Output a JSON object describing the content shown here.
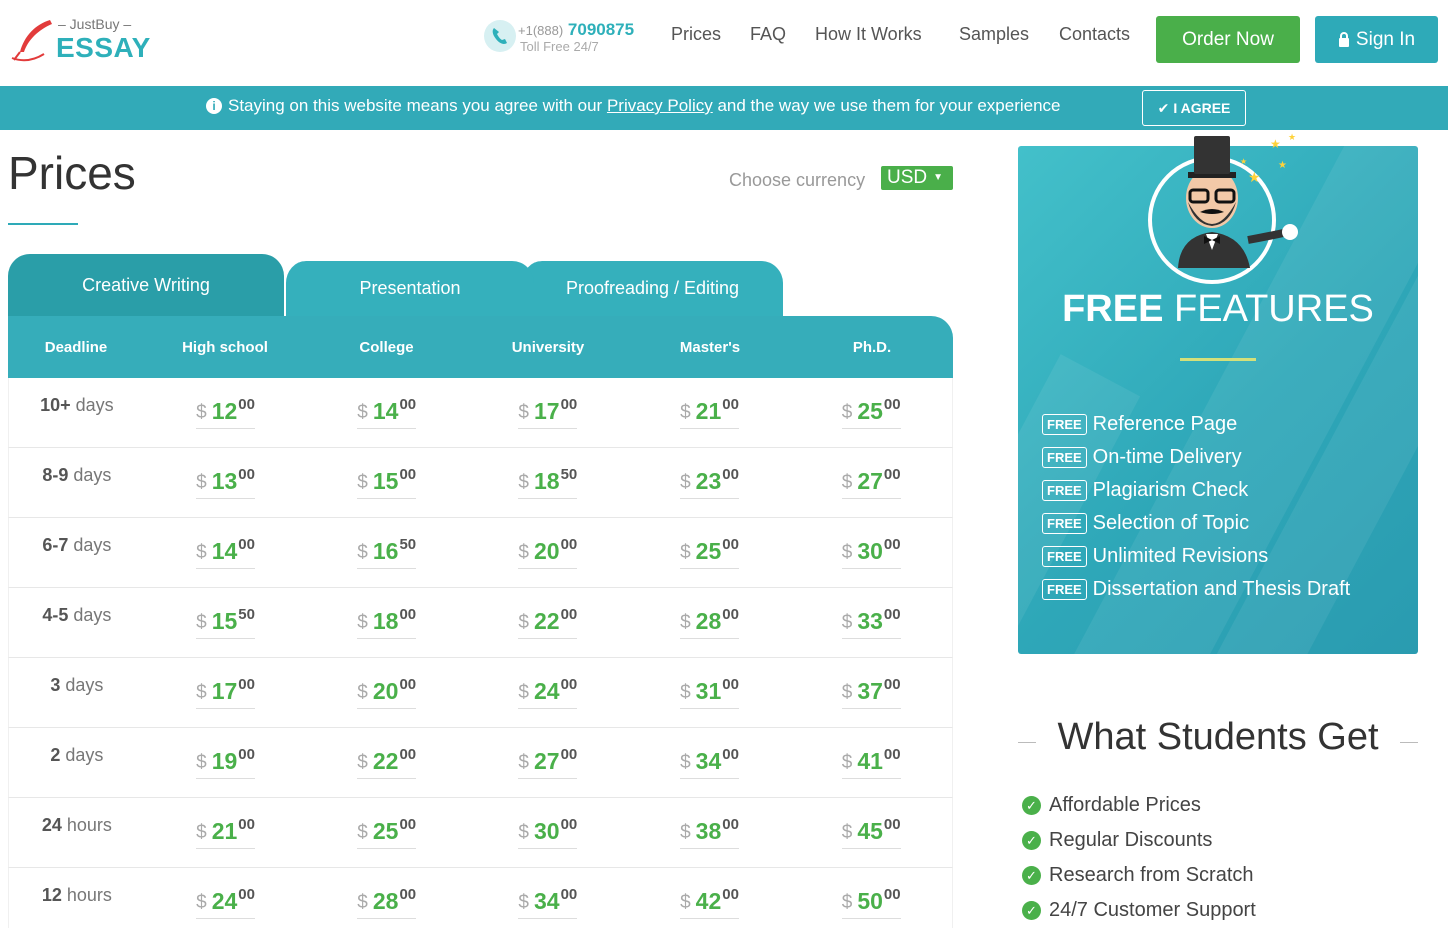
{
  "header": {
    "logo_top": "– JustBuy –",
    "logo_main": "ESSAY",
    "phone_prefix": "+1(888)",
    "phone_number": "7090875",
    "phone_sub": "Toll Free 24/7",
    "nav": [
      "Prices",
      "FAQ",
      "How It Works",
      "Samples",
      "Contacts"
    ],
    "order_label": "Order Now",
    "signin_label": "Sign In"
  },
  "cookie": {
    "text_before": "Staying on this website means you agree with our ",
    "link": "Privacy Policy",
    "text_after": " and the way we use them for your experience",
    "agree_label": "I AGREE"
  },
  "page": {
    "title": "Prices",
    "currency_label": "Choose currency",
    "currency_value": "USD"
  },
  "tabs": [
    "Creative Writing",
    "Presentation",
    "Proofreading / Editing"
  ],
  "table": {
    "headers": [
      "Deadline",
      "High school",
      "College",
      "University",
      "Master's",
      "Ph.D."
    ],
    "currency_symbol": "$",
    "rows": [
      {
        "num": "10+",
        "unit": "days",
        "prices": [
          [
            "12",
            "00"
          ],
          [
            "14",
            "00"
          ],
          [
            "17",
            "00"
          ],
          [
            "21",
            "00"
          ],
          [
            "25",
            "00"
          ]
        ]
      },
      {
        "num": "8-9",
        "unit": "days",
        "prices": [
          [
            "13",
            "00"
          ],
          [
            "15",
            "00"
          ],
          [
            "18",
            "50"
          ],
          [
            "23",
            "00"
          ],
          [
            "27",
            "00"
          ]
        ]
      },
      {
        "num": "6-7",
        "unit": "days",
        "prices": [
          [
            "14",
            "00"
          ],
          [
            "16",
            "50"
          ],
          [
            "20",
            "00"
          ],
          [
            "25",
            "00"
          ],
          [
            "30",
            "00"
          ]
        ]
      },
      {
        "num": "4-5",
        "unit": "days",
        "prices": [
          [
            "15",
            "50"
          ],
          [
            "18",
            "00"
          ],
          [
            "22",
            "00"
          ],
          [
            "28",
            "00"
          ],
          [
            "33",
            "00"
          ]
        ]
      },
      {
        "num": "3",
        "unit": "days",
        "prices": [
          [
            "17",
            "00"
          ],
          [
            "20",
            "00"
          ],
          [
            "24",
            "00"
          ],
          [
            "31",
            "00"
          ],
          [
            "37",
            "00"
          ]
        ]
      },
      {
        "num": "2",
        "unit": "days",
        "prices": [
          [
            "19",
            "00"
          ],
          [
            "22",
            "00"
          ],
          [
            "27",
            "00"
          ],
          [
            "34",
            "00"
          ],
          [
            "41",
            "00"
          ]
        ]
      },
      {
        "num": "24",
        "unit": "hours",
        "prices": [
          [
            "21",
            "00"
          ],
          [
            "25",
            "00"
          ],
          [
            "30",
            "00"
          ],
          [
            "38",
            "00"
          ],
          [
            "45",
            "00"
          ]
        ]
      },
      {
        "num": "12",
        "unit": "hours",
        "prices": [
          [
            "24",
            "00"
          ],
          [
            "28",
            "00"
          ],
          [
            "34",
            "00"
          ],
          [
            "42",
            "00"
          ],
          [
            "50",
            "00"
          ]
        ]
      }
    ]
  },
  "features": {
    "title_bold": "FREE",
    "title_rest": " FEATURES",
    "badge": "FREE",
    "items": [
      "Reference Page",
      "On-time Delivery",
      "Plagiarism Check",
      "Selection of Topic",
      "Unlimited Revisions",
      "Dissertation and Thesis Draft"
    ]
  },
  "students": {
    "title": "What Students Get",
    "items": [
      "Affordable Prices",
      "Regular Discounts",
      "Research from Scratch",
      "24/7 Customer Support"
    ]
  },
  "colors": {
    "teal": "#32aab8",
    "green": "#4aaf4a"
  }
}
